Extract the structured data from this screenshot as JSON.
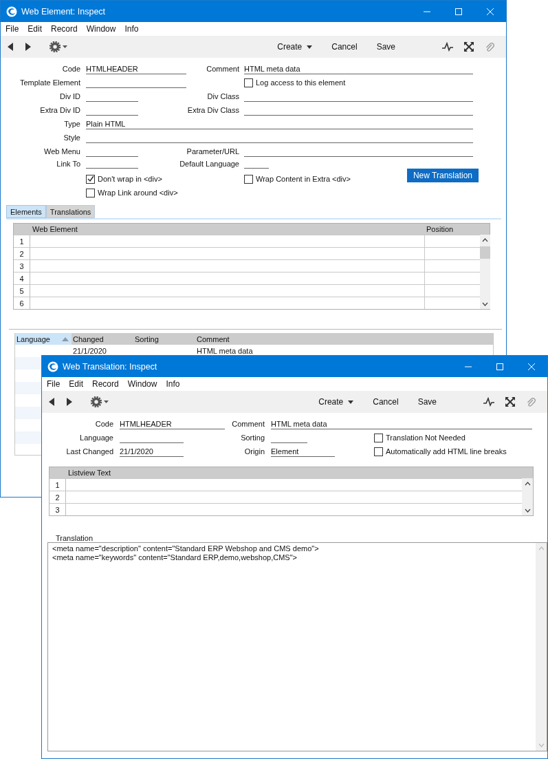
{
  "windows": [
    {
      "title": "Web Element: Inspect",
      "menu": [
        "File",
        "Edit",
        "Record",
        "Window",
        "Info"
      ],
      "toolbar": [
        "Create",
        "Cancel",
        "Save"
      ],
      "form": [
        [
          {
            "kind": "field",
            "label": "Code",
            "value": "HTMLHEADER"
          },
          {
            "kind": "field",
            "label": "Comment",
            "value": "HTML meta data"
          }
        ],
        [
          {
            "kind": "field",
            "label": "Template Element"
          },
          {
            "kind": "checkbox",
            "label": "Log access to this element",
            "checked": false
          }
        ],
        [
          {
            "kind": "field",
            "label": "Div ID"
          },
          {
            "kind": "field",
            "label": "Div Class"
          }
        ],
        [
          {
            "kind": "field",
            "label": "Extra Div ID"
          },
          {
            "kind": "field",
            "label": "Extra Div Class"
          }
        ],
        [
          {
            "kind": "field",
            "label": "Type",
            "value": "Plain HTML"
          }
        ],
        [
          {
            "kind": "field",
            "label": "Style"
          }
        ],
        [
          {
            "kind": "field",
            "label": "Web Menu"
          },
          {
            "kind": "field",
            "label": "Parameter/URL"
          }
        ],
        [
          {
            "kind": "field",
            "label": "Link To"
          },
          {
            "kind": "field",
            "label": "Default Language"
          },
          {
            "kind": "button",
            "label": "New Translation"
          }
        ],
        [
          {
            "kind": "checkbox",
            "label": "Don't wrap in <div>",
            "checked": true
          },
          {
            "kind": "checkbox",
            "label": "Wrap Content in Extra <div>",
            "checked": false
          }
        ],
        [
          {
            "kind": "checkbox",
            "label": "Wrap Link around <div>",
            "checked": false
          }
        ]
      ],
      "tabs": [
        {
          "label": "Elements",
          "selected": true
        },
        {
          "label": "Translations",
          "selected": false
        }
      ],
      "grid": {
        "columns": [
          "Web Element",
          "Position"
        ],
        "rows": [
          "1",
          "2",
          "3",
          "4",
          "5",
          "6"
        ]
      },
      "list": {
        "columns": [
          {
            "label": "Language",
            "sorted": true
          },
          {
            "label": "Changed",
            "sorted": false
          },
          {
            "label": "Sorting",
            "sorted": false
          },
          {
            "label": "Comment",
            "sorted": false
          }
        ],
        "rows": [
          {
            "cells": [
              null,
              "21/1/2020",
              null,
              "HTML meta data"
            ]
          }
        ]
      }
    },
    {
      "title": "Web Translation: Inspect",
      "menu": [
        "File",
        "Edit",
        "Record",
        "Window",
        "Info"
      ],
      "toolbar": [
        "Create",
        "Cancel",
        "Save"
      ],
      "form": [
        [
          {
            "kind": "field",
            "label": "Code",
            "value": "HTMLHEADER"
          },
          {
            "kind": "field",
            "label": "Comment",
            "value": "HTML meta data"
          }
        ],
        [
          {
            "kind": "field",
            "label": "Language"
          },
          {
            "kind": "field",
            "label": "Sorting"
          },
          {
            "kind": "checkbox",
            "label": "Translation Not Needed",
            "checked": false
          }
        ],
        [
          {
            "kind": "field",
            "label": "Last Changed",
            "value": "21/1/2020"
          },
          {
            "kind": "field",
            "label": "Origin",
            "value": "Element"
          },
          {
            "kind": "checkbox",
            "label": "Automatically add HTML line breaks",
            "checked": false
          }
        ]
      ],
      "grid": {
        "columns": [
          "Listview Text"
        ],
        "rows": [
          "1",
          "2",
          "3"
        ]
      },
      "translation": {
        "label": "Translation",
        "value": "<meta name=\"description\" content=\"Standard ERP Webshop and CMS demo\">\n<meta name=\"keywords\" content=\"Standard ERP,demo,webshop,CMS\">"
      }
    }
  ]
}
